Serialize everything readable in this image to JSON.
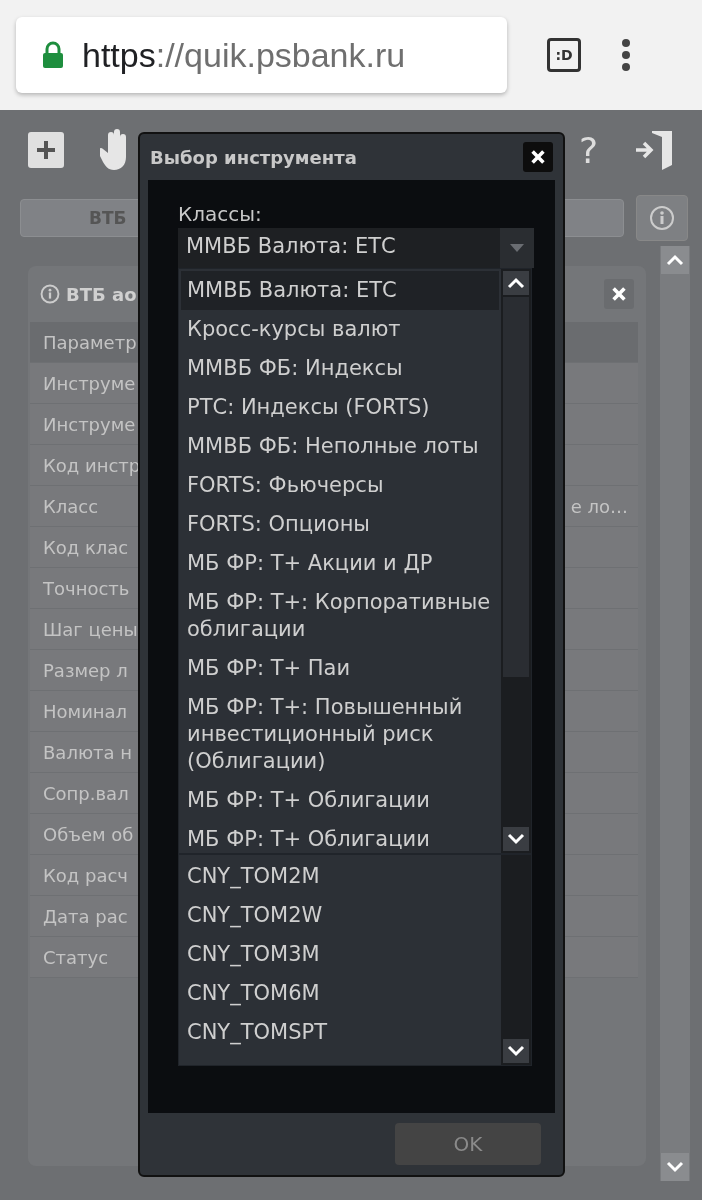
{
  "browser": {
    "url_scheme": "https",
    "url_rest": "://quik.psbank.ru",
    "tabs_icon": ":D"
  },
  "toolbar": {
    "help": "?"
  },
  "instrument_button": "ВТБ",
  "panel": {
    "title": "ВТБ ао",
    "rows": [
      {
        "label": "Параметр",
        "selected": true
      },
      {
        "label": "Инструме",
        "selected": false
      },
      {
        "label": "Инструме",
        "selected": false
      },
      {
        "label": "Код инстр",
        "selected": false
      },
      {
        "label": "Класс",
        "value": "е ло…",
        "selected": false
      },
      {
        "label": "Код клас",
        "selected": false
      },
      {
        "label": "Точность",
        "selected": false
      },
      {
        "label": "Шаг цены",
        "selected": false
      },
      {
        "label": "Размер л",
        "selected": false
      },
      {
        "label": "Номинал",
        "selected": false
      },
      {
        "label": "Валюта н",
        "selected": false
      },
      {
        "label": "Сопр.вал",
        "selected": false
      },
      {
        "label": "Объем об",
        "selected": false
      },
      {
        "label": "Код расч",
        "selected": false
      },
      {
        "label": "Дата рас",
        "selected": false
      },
      {
        "label": "Статус",
        "selected": false
      }
    ]
  },
  "dialog": {
    "title": "Выбор инструмента",
    "classes_label": "Классы:",
    "classes_value": "ММВБ Валюта: ЕТС",
    "class_options": [
      {
        "label": "ММВБ Валюта: ЕТС",
        "selected": true
      },
      {
        "label": "Кросс-курсы валют",
        "selected": false
      },
      {
        "label": "ММВБ ФБ: Индексы",
        "selected": false
      },
      {
        "label": "РТС: Индексы (FORTS)",
        "selected": false
      },
      {
        "label": "ММВБ ФБ: Неполные лоты",
        "selected": false
      },
      {
        "label": "FORTS: Фьючерсы",
        "selected": false
      },
      {
        "label": "FORTS: Опционы",
        "selected": false
      },
      {
        "label": "МБ ФР: Т+ Акции и ДР",
        "selected": false
      },
      {
        "label": "МБ ФР: Т+: Корпоративные облигации",
        "selected": false
      },
      {
        "label": "МБ ФР: Т+ Паи",
        "selected": false
      },
      {
        "label": "МБ ФР: Т+: Повышенный инвестиционный риск (Облигации)",
        "selected": false
      },
      {
        "label": "МБ ФР: Т+ Облигации",
        "selected": false
      },
      {
        "label": "МБ ФР: Т+ Облигации",
        "selected": false
      }
    ],
    "instruments": [
      {
        "label": "CNY_TOM2M",
        "selected": false
      },
      {
        "label": "CNY_TOM2W",
        "selected": false
      },
      {
        "label": "CNY_TOM3M",
        "selected": false
      },
      {
        "label": "CNY_TOM6M",
        "selected": false
      },
      {
        "label": "CNY_TOMSPT",
        "selected": false
      }
    ],
    "ok": {
      "label": "OK",
      "disabled": true
    }
  }
}
